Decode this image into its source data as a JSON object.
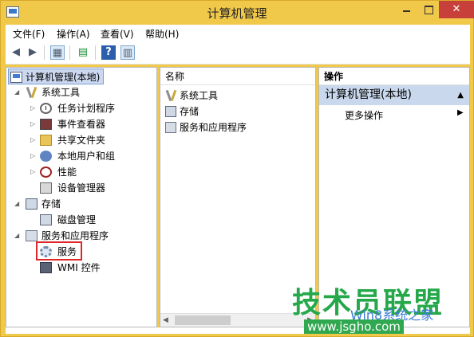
{
  "window": {
    "title": "计算机管理",
    "close_glyph": "✕"
  },
  "menu": {
    "items": [
      "文件(F)",
      "操作(A)",
      "查看(V)",
      "帮助(H)"
    ]
  },
  "toolbar": {
    "icons": [
      "back-arrow-icon",
      "forward-arrow-icon",
      "show-tree-icon",
      "export-list-icon",
      "help-icon",
      "show-action-pane-icon"
    ]
  },
  "tree": {
    "root": "计算机管理(本地)",
    "items": [
      {
        "label": "系统工具",
        "icon": "tools-icon"
      },
      {
        "label": "任务计划程序",
        "icon": "task-scheduler-icon"
      },
      {
        "label": "事件查看器",
        "icon": "event-viewer-icon"
      },
      {
        "label": "共享文件夹",
        "icon": "shared-folder-icon"
      },
      {
        "label": "本地用户和组",
        "icon": "users-icon"
      },
      {
        "label": "性能",
        "icon": "performance-icon"
      },
      {
        "label": "设备管理器",
        "icon": "device-manager-icon"
      },
      {
        "label": "存储",
        "icon": "storage-icon"
      },
      {
        "label": "磁盘管理",
        "icon": "disk-icon"
      },
      {
        "label": "服务和应用程序",
        "icon": "services-apps-icon"
      },
      {
        "label": "服务",
        "icon": "gear-icon"
      },
      {
        "label": "WMI 控件",
        "icon": "wmi-icon"
      }
    ]
  },
  "list": {
    "column": "名称",
    "items": [
      "系统工具",
      "存储",
      "服务和应用程序"
    ]
  },
  "actions": {
    "header": "操作",
    "section": "计算机管理(本地)",
    "more": "更多操作"
  },
  "watermark": {
    "main": "技术员联盟",
    "sub": "Win8系统之家",
    "url": "www.jsgho.com"
  }
}
